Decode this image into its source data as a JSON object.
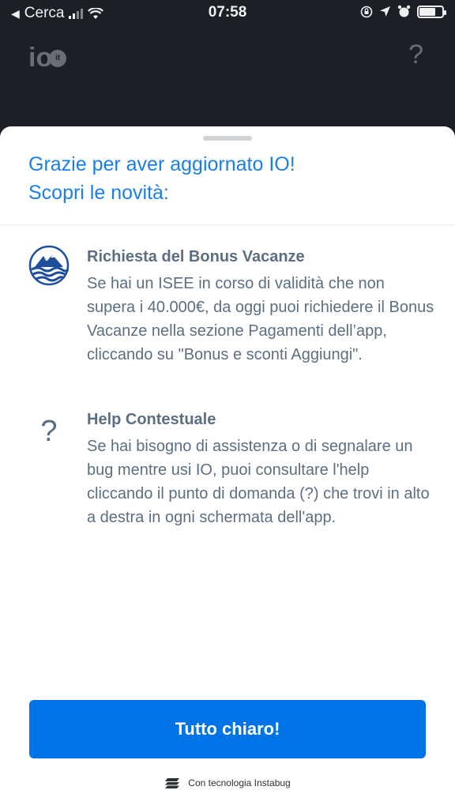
{
  "status_bar": {
    "carrier": "Cerca",
    "time": "07:58"
  },
  "app_header": {
    "logo_text": "io",
    "logo_badge": "it",
    "help_glyph": "?"
  },
  "sheet": {
    "title_line1": "Grazie per aver aggiornato IO!",
    "title_line2": "Scopri le novità:",
    "features": [
      {
        "icon": "bonus-vacanze-icon",
        "title": "Richiesta del Bonus Vacanze",
        "description": "Se hai un ISEE in corso di validità che non supera i 40.000€, da oggi puoi richiedere il Bonus Vacanze nella sezione Pagamenti dell’app, cliccando su \"Bonus e sconti Aggiungi\"."
      },
      {
        "icon": "question-mark-icon",
        "icon_glyph": "?",
        "title": "Help Contestuale",
        "description": "Se hai bisogno di assistenza o di segnalare un bug mentre usi IO, puoi consultare l'help cliccando il punto di domanda (?) che trovi in alto a destra in ogni schermata dell'app."
      }
    ],
    "cta_label": "Tutto chiaro!",
    "powered_by": "Con tecnologia Instabug"
  },
  "colors": {
    "accent": "#0073e6",
    "title_blue": "#1a7fe6",
    "body_text": "#5c6f82"
  }
}
